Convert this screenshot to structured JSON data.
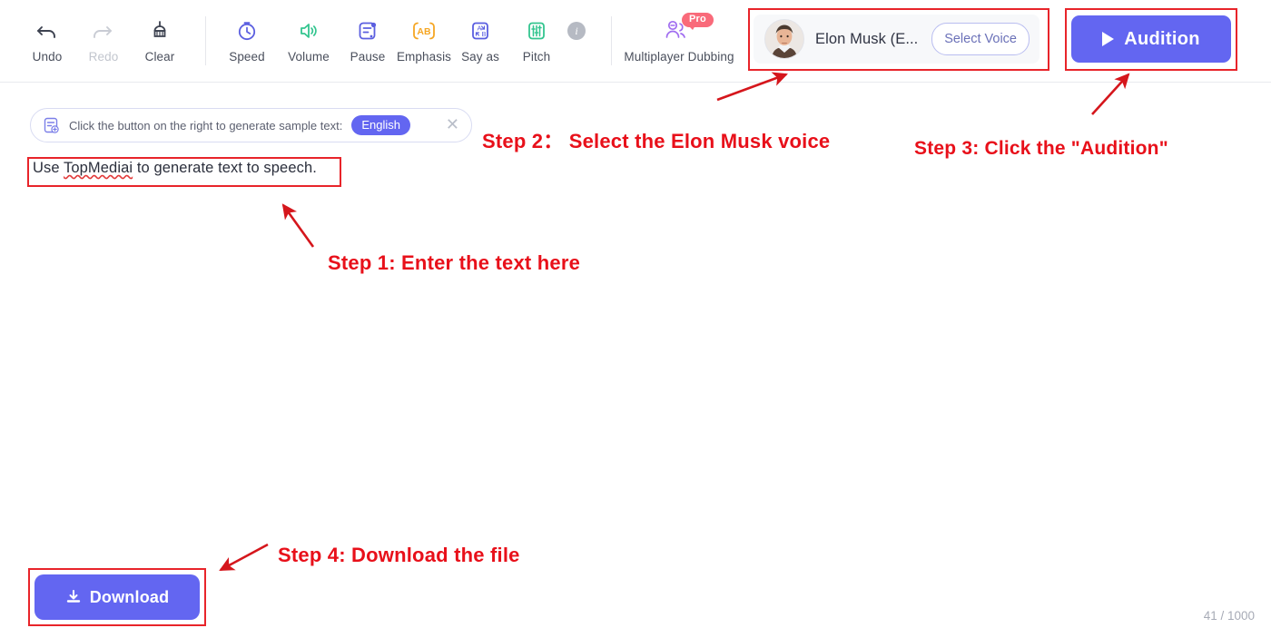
{
  "toolbar": {
    "items": [
      {
        "id": "undo",
        "label": "Undo",
        "icon": "undo-arrow-icon",
        "disabled": false
      },
      {
        "id": "redo",
        "label": "Redo",
        "icon": "redo-arrow-icon",
        "disabled": true
      },
      {
        "id": "clear",
        "label": "Clear",
        "icon": "broom-icon",
        "disabled": false
      },
      {
        "id": "speed",
        "label": "Speed",
        "icon": "stopwatch-icon",
        "disabled": false
      },
      {
        "id": "volume",
        "label": "Volume",
        "icon": "speaker-icon",
        "disabled": false
      },
      {
        "id": "pause",
        "label": "Pause",
        "icon": "pause-insert-icon",
        "disabled": false
      },
      {
        "id": "emphasis",
        "label": "Emphasis",
        "icon": "emphasis-ab-icon",
        "disabled": false
      },
      {
        "id": "sayas",
        "label": "Say as",
        "icon": "say-as-icon",
        "disabled": false
      },
      {
        "id": "pitch",
        "label": "Pitch",
        "icon": "pitch-sliders-icon",
        "disabled": false
      },
      {
        "id": "dubbing",
        "label": "Multiplayer Dubbing",
        "icon": "people-icon",
        "disabled": false
      }
    ],
    "info_icon": "info-circle-icon",
    "pro_badge": "Pro"
  },
  "voice": {
    "name": "Elon Musk (E...",
    "avatar_icon": "avatar-elon-musk",
    "select_button": "Select Voice"
  },
  "audition": {
    "label": "Audition",
    "icon": "play-icon"
  },
  "sample_bar": {
    "icon": "add-document-icon",
    "hint": "Click the button on the right to generate sample text:",
    "language": "English",
    "close_icon": "close-icon"
  },
  "editor": {
    "text_before": "Use ",
    "text_misspelled": "TopMediai",
    "text_after": " to generate text to speech.",
    "full_text": "Use TopMediai to generate text to speech."
  },
  "download": {
    "label": "Download",
    "icon": "download-icon"
  },
  "counter": {
    "text": "41 / 1000"
  },
  "annotations": [
    {
      "id": "step1",
      "text": "Step 1: Enter the text here"
    },
    {
      "id": "step2",
      "text": "Step 2： Select the Elon Musk voice"
    },
    {
      "id": "step3",
      "text": "Step 3: Click the \"Audition\""
    },
    {
      "id": "step4",
      "text": "Step 4: Download the file"
    }
  ],
  "colors": {
    "accent": "#6366f1",
    "annotation_red": "#e8101a",
    "pro_badge": "#f96a7a"
  }
}
